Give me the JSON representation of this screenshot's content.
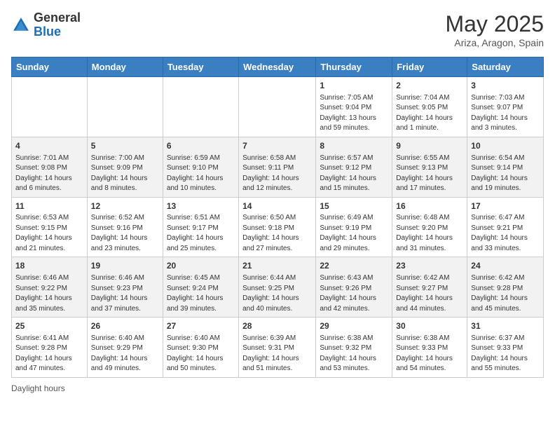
{
  "header": {
    "logo_general": "General",
    "logo_blue": "Blue",
    "month_title": "May 2025",
    "location": "Ariza, Aragon, Spain"
  },
  "days_of_week": [
    "Sunday",
    "Monday",
    "Tuesday",
    "Wednesday",
    "Thursday",
    "Friday",
    "Saturday"
  ],
  "weeks": [
    [
      {
        "day": "",
        "info": ""
      },
      {
        "day": "",
        "info": ""
      },
      {
        "day": "",
        "info": ""
      },
      {
        "day": "",
        "info": ""
      },
      {
        "day": "1",
        "info": "Sunrise: 7:05 AM\nSunset: 9:04 PM\nDaylight: 13 hours and 59 minutes."
      },
      {
        "day": "2",
        "info": "Sunrise: 7:04 AM\nSunset: 9:05 PM\nDaylight: 14 hours and 1 minute."
      },
      {
        "day": "3",
        "info": "Sunrise: 7:03 AM\nSunset: 9:07 PM\nDaylight: 14 hours and 3 minutes."
      }
    ],
    [
      {
        "day": "4",
        "info": "Sunrise: 7:01 AM\nSunset: 9:08 PM\nDaylight: 14 hours and 6 minutes."
      },
      {
        "day": "5",
        "info": "Sunrise: 7:00 AM\nSunset: 9:09 PM\nDaylight: 14 hours and 8 minutes."
      },
      {
        "day": "6",
        "info": "Sunrise: 6:59 AM\nSunset: 9:10 PM\nDaylight: 14 hours and 10 minutes."
      },
      {
        "day": "7",
        "info": "Sunrise: 6:58 AM\nSunset: 9:11 PM\nDaylight: 14 hours and 12 minutes."
      },
      {
        "day": "8",
        "info": "Sunrise: 6:57 AM\nSunset: 9:12 PM\nDaylight: 14 hours and 15 minutes."
      },
      {
        "day": "9",
        "info": "Sunrise: 6:55 AM\nSunset: 9:13 PM\nDaylight: 14 hours and 17 minutes."
      },
      {
        "day": "10",
        "info": "Sunrise: 6:54 AM\nSunset: 9:14 PM\nDaylight: 14 hours and 19 minutes."
      }
    ],
    [
      {
        "day": "11",
        "info": "Sunrise: 6:53 AM\nSunset: 9:15 PM\nDaylight: 14 hours and 21 minutes."
      },
      {
        "day": "12",
        "info": "Sunrise: 6:52 AM\nSunset: 9:16 PM\nDaylight: 14 hours and 23 minutes."
      },
      {
        "day": "13",
        "info": "Sunrise: 6:51 AM\nSunset: 9:17 PM\nDaylight: 14 hours and 25 minutes."
      },
      {
        "day": "14",
        "info": "Sunrise: 6:50 AM\nSunset: 9:18 PM\nDaylight: 14 hours and 27 minutes."
      },
      {
        "day": "15",
        "info": "Sunrise: 6:49 AM\nSunset: 9:19 PM\nDaylight: 14 hours and 29 minutes."
      },
      {
        "day": "16",
        "info": "Sunrise: 6:48 AM\nSunset: 9:20 PM\nDaylight: 14 hours and 31 minutes."
      },
      {
        "day": "17",
        "info": "Sunrise: 6:47 AM\nSunset: 9:21 PM\nDaylight: 14 hours and 33 minutes."
      }
    ],
    [
      {
        "day": "18",
        "info": "Sunrise: 6:46 AM\nSunset: 9:22 PM\nDaylight: 14 hours and 35 minutes."
      },
      {
        "day": "19",
        "info": "Sunrise: 6:46 AM\nSunset: 9:23 PM\nDaylight: 14 hours and 37 minutes."
      },
      {
        "day": "20",
        "info": "Sunrise: 6:45 AM\nSunset: 9:24 PM\nDaylight: 14 hours and 39 minutes."
      },
      {
        "day": "21",
        "info": "Sunrise: 6:44 AM\nSunset: 9:25 PM\nDaylight: 14 hours and 40 minutes."
      },
      {
        "day": "22",
        "info": "Sunrise: 6:43 AM\nSunset: 9:26 PM\nDaylight: 14 hours and 42 minutes."
      },
      {
        "day": "23",
        "info": "Sunrise: 6:42 AM\nSunset: 9:27 PM\nDaylight: 14 hours and 44 minutes."
      },
      {
        "day": "24",
        "info": "Sunrise: 6:42 AM\nSunset: 9:28 PM\nDaylight: 14 hours and 45 minutes."
      }
    ],
    [
      {
        "day": "25",
        "info": "Sunrise: 6:41 AM\nSunset: 9:28 PM\nDaylight: 14 hours and 47 minutes."
      },
      {
        "day": "26",
        "info": "Sunrise: 6:40 AM\nSunset: 9:29 PM\nDaylight: 14 hours and 49 minutes."
      },
      {
        "day": "27",
        "info": "Sunrise: 6:40 AM\nSunset: 9:30 PM\nDaylight: 14 hours and 50 minutes."
      },
      {
        "day": "28",
        "info": "Sunrise: 6:39 AM\nSunset: 9:31 PM\nDaylight: 14 hours and 51 minutes."
      },
      {
        "day": "29",
        "info": "Sunrise: 6:38 AM\nSunset: 9:32 PM\nDaylight: 14 hours and 53 minutes."
      },
      {
        "day": "30",
        "info": "Sunrise: 6:38 AM\nSunset: 9:33 PM\nDaylight: 14 hours and 54 minutes."
      },
      {
        "day": "31",
        "info": "Sunrise: 6:37 AM\nSunset: 9:33 PM\nDaylight: 14 hours and 55 minutes."
      }
    ]
  ],
  "footer": {
    "daylight_hours": "Daylight hours"
  }
}
